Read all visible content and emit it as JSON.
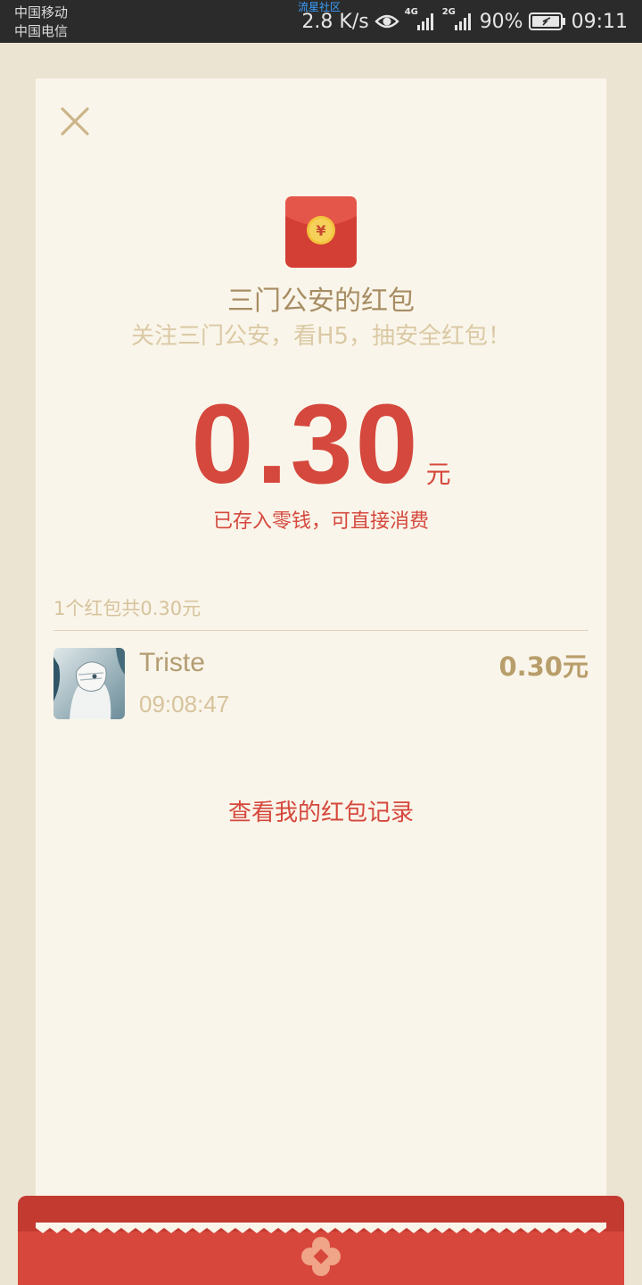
{
  "status_bar": {
    "carrier1": "中国移动",
    "carrier2": "中国电信",
    "watermark": "流星社区",
    "net_speed": "2.8 K/s",
    "battery": "90%",
    "time": "09:11",
    "network1": "4G",
    "network2": "2G"
  },
  "envelope": {
    "sender_title": "三门公安的红包",
    "blessing": "关注三门公安，看H5，抽安全红包！",
    "amount": "0.30",
    "amount_unit": "元",
    "saved_note": "已存入零钱，可直接消费"
  },
  "records": {
    "summary": "1个红包共0.30元",
    "items": [
      {
        "name": "Triste",
        "time": "09:08:47",
        "amount": "0.30元"
      }
    ]
  },
  "actions": {
    "history_link": "查看我的红包记录"
  },
  "icons": {
    "close": "close-icon",
    "envelope": "red-envelope-icon",
    "eye": "eye-icon",
    "battery": "battery-icon"
  },
  "colors": {
    "accent_red": "#d5483d",
    "gold_text": "#a78d63",
    "card_bg": "#faf5ea",
    "page_bg": "#ece4d3"
  }
}
